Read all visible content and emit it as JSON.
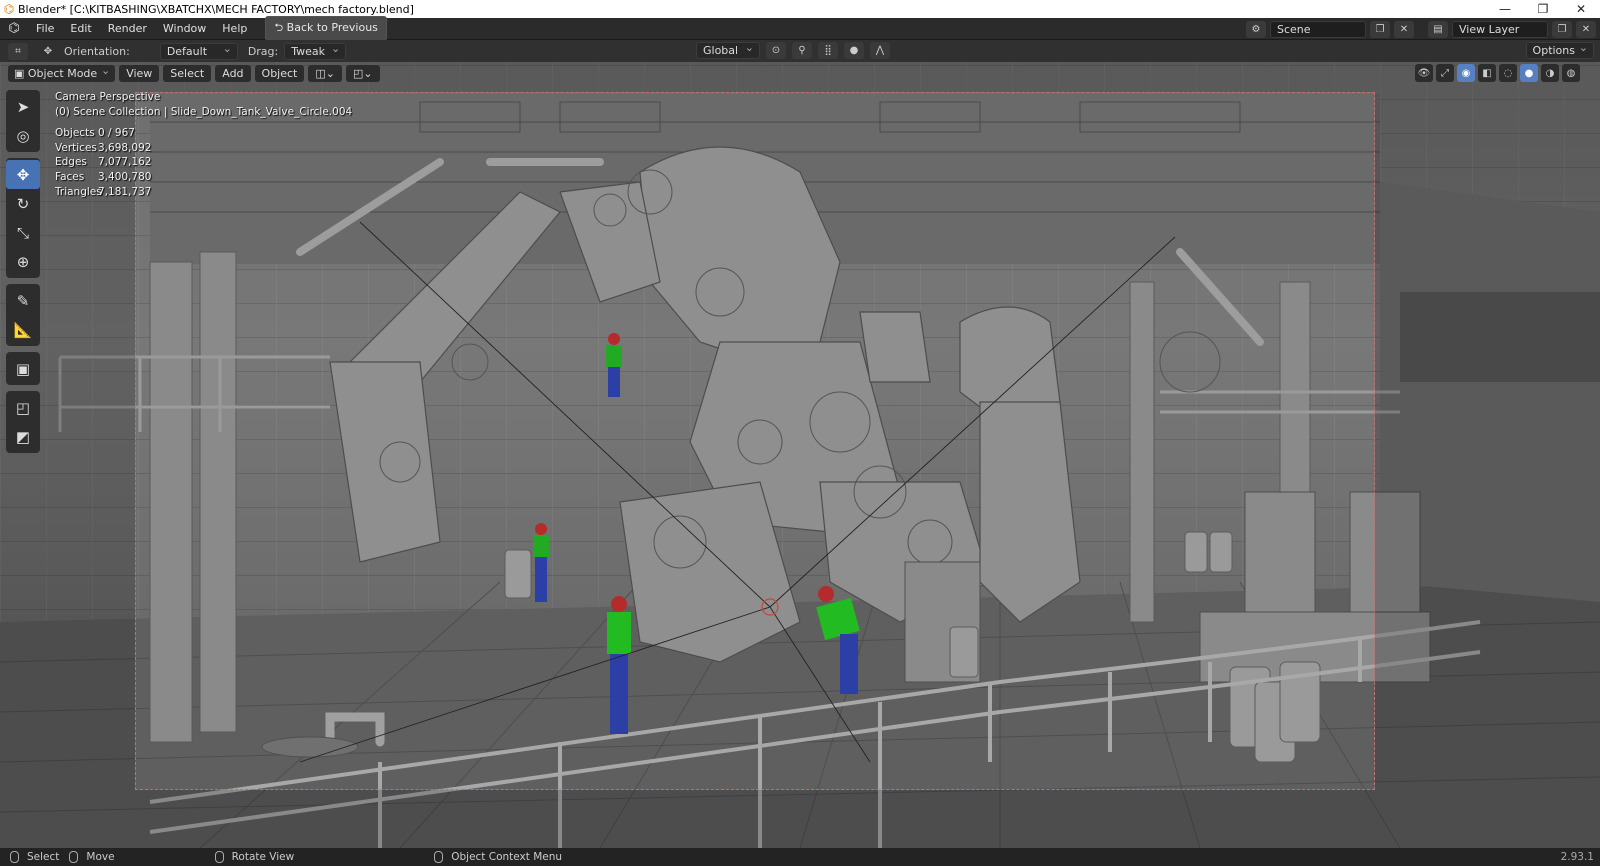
{
  "window": {
    "title": "Blender* [C:\\KITBASHING\\XBATCHX\\MECH FACTORY\\mech factory.blend]",
    "controls": [
      "—",
      "❐",
      "✕"
    ]
  },
  "menubar": {
    "items": [
      "File",
      "Edit",
      "Render",
      "Window",
      "Help"
    ],
    "back_button": "Back to Previous",
    "scene_name": "Scene",
    "view_layer": "View Layer"
  },
  "tool_header": {
    "orientation_label": "Orientation:",
    "orientation_value": "Default",
    "drag_label": "Drag:",
    "drag_value": "Tweak",
    "transform_space": "Global",
    "options_label": "Options"
  },
  "viewport_header": {
    "mode": "Object Mode",
    "menus": [
      "View",
      "Select",
      "Add",
      "Object"
    ]
  },
  "toolbar": {
    "tools": [
      {
        "name": "select-box",
        "glyph": "➤"
      },
      {
        "name": "cursor",
        "glyph": "◎"
      },
      {
        "name": "move",
        "glyph": "✥",
        "active": true
      },
      {
        "name": "rotate",
        "glyph": "↻"
      },
      {
        "name": "scale",
        "glyph": "⤡"
      },
      {
        "name": "transform",
        "glyph": "⊕"
      },
      {
        "name": "annotate",
        "glyph": "✎"
      },
      {
        "name": "measure",
        "glyph": "📐"
      },
      {
        "name": "add-cube",
        "glyph": "▣"
      },
      {
        "name": "extrude",
        "glyph": "◰"
      },
      {
        "name": "inset",
        "glyph": "◩"
      }
    ]
  },
  "overlay": {
    "view_name": "Camera Perspective",
    "collection": "(0) Scene Collection | Slide_Down_Tank_Valve_Circle.004",
    "stats": [
      {
        "label": "Objects",
        "value": "0 / 967"
      },
      {
        "label": "Vertices",
        "value": "3,698,092"
      },
      {
        "label": "Edges",
        "value": "7,077,162"
      },
      {
        "label": "Faces",
        "value": "3,400,780"
      },
      {
        "label": "Triangles",
        "value": "7,181,737"
      }
    ]
  },
  "statusbar": {
    "select": "Select",
    "move": "Move",
    "rotate_view": "Rotate View",
    "context_menu": "Object Context Menu",
    "version": "2.93.1"
  }
}
